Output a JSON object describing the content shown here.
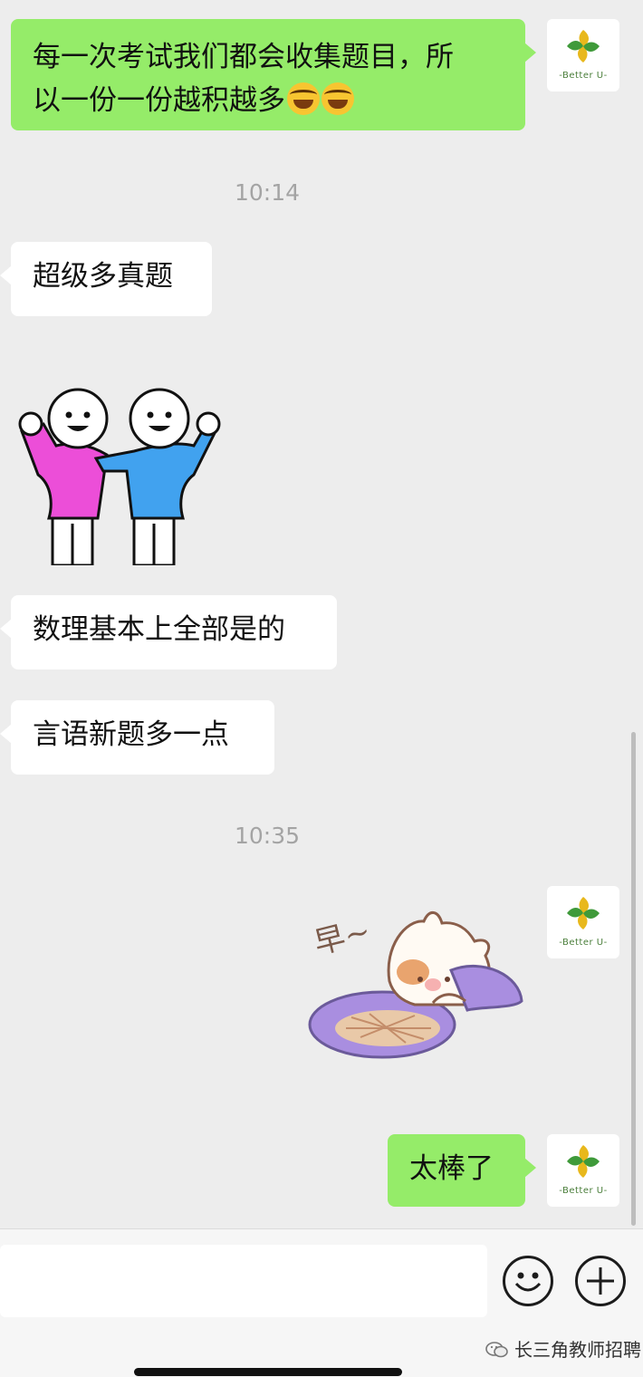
{
  "messages": {
    "m1": "每一次考试我们都会收集题目，所",
    "m1_line2": "以一份一份越积越多",
    "m2": "超级多真题",
    "m3": "数理基本上全部是的",
    "m4": "言语新题多一点",
    "m5": "太棒了"
  },
  "timestamps": {
    "t1": "10:14",
    "t2": "10:35"
  },
  "avatar": {
    "label": "-Better U-"
  },
  "stickers": {
    "sticker2_text": "早~"
  },
  "input": {
    "placeholder": ""
  },
  "watermark": {
    "text": "长三角教师招聘"
  },
  "colors": {
    "my_bubble": "#95ec69",
    "other_bubble": "#ffffff",
    "background": "#ededed"
  },
  "icons": [
    "emoji-face-icon",
    "plus-icon",
    "wechat-logo-icon"
  ]
}
